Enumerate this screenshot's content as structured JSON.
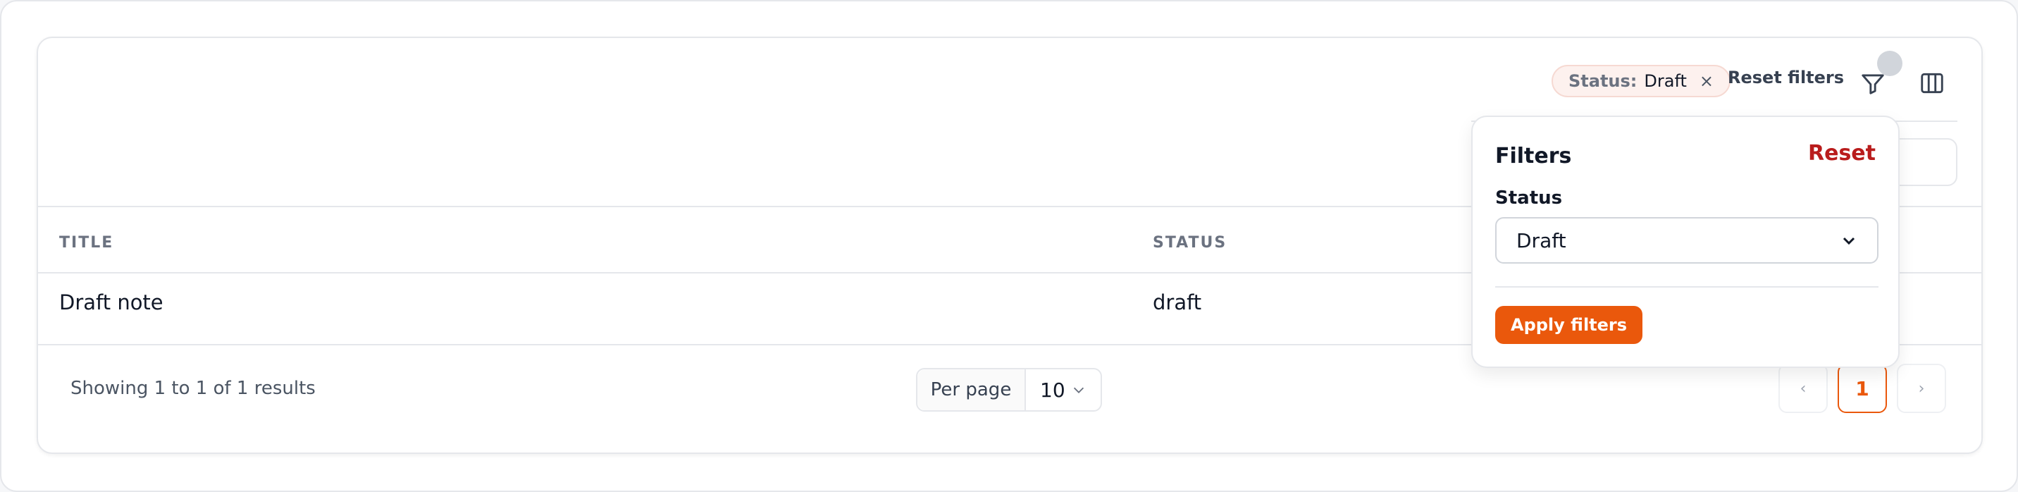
{
  "toolbar": {
    "chip_key": "Status:",
    "chip_value": "Draft",
    "chip_remove_symbol": "×",
    "reset_filters_label": "Reset filters"
  },
  "table": {
    "headers": [
      "TITLE",
      "STATUS"
    ],
    "rows": [
      {
        "title": "Draft note",
        "status": "draft"
      }
    ]
  },
  "footer": {
    "showing_text": "Showing 1 to 1 of 1 results",
    "per_page_label": "Per page",
    "per_page_value": "10",
    "pager": {
      "prev": "‹",
      "current": "1",
      "next": "›"
    }
  },
  "filters_popover": {
    "title": "Filters",
    "reset_label": "Reset",
    "status_label": "Status",
    "status_selected": "Draft",
    "apply_label": "Apply filters"
  },
  "colors": {
    "accent": "#ea580c",
    "danger": "#b91c1c",
    "chip_bg": "#fdf1ee"
  },
  "icons": {
    "filter": "funnel-icon",
    "columns": "columns-icon",
    "remove": "close-icon",
    "dropdown": "chevron-down-icon"
  }
}
